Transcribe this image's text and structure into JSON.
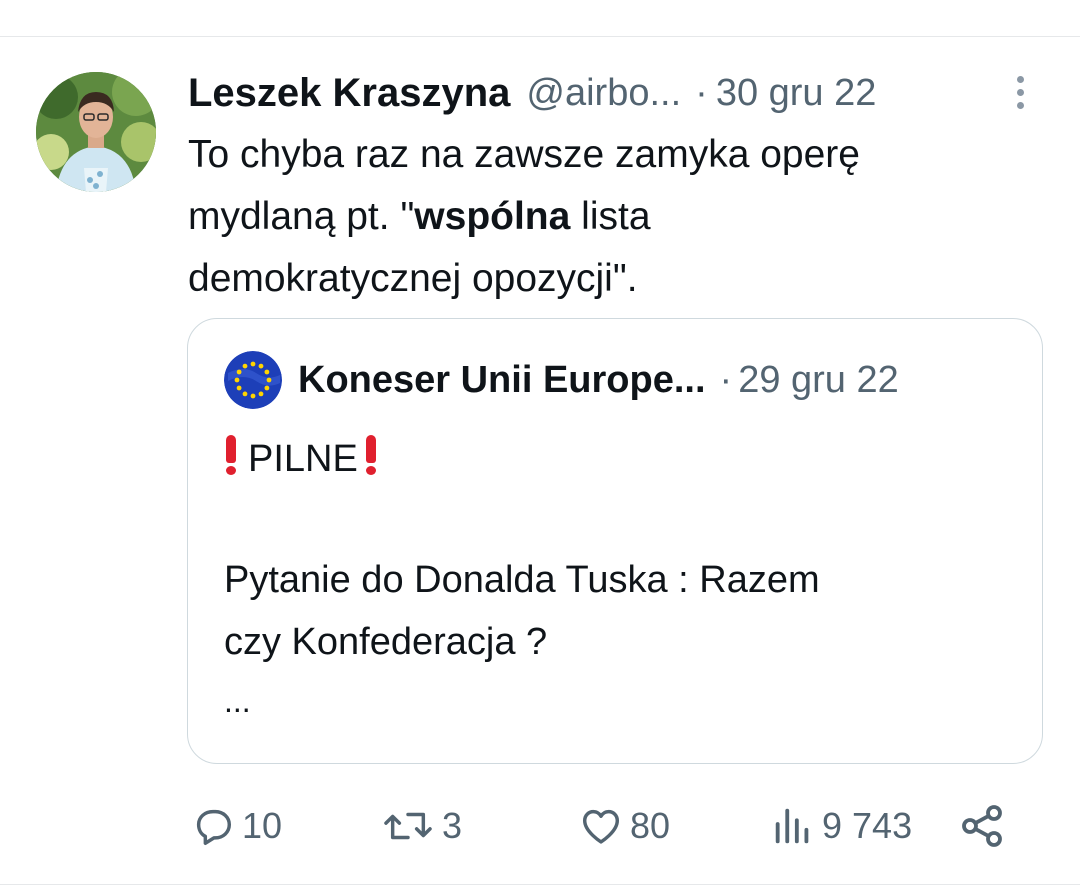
{
  "tweet": {
    "author_name": "Leszek Kraszyna",
    "author_handle": "@airbo...",
    "separator": "·",
    "date": "30 gru 22",
    "text_line1": "To chyba raz na zawsze zamyka operę",
    "text_line2_pre": "mydlaną pt. \"",
    "text_line2_bold": "wspólna",
    "text_line2_post": " lista",
    "text_line3": "demokratycznej opozycji\"."
  },
  "quote": {
    "author_name": "Koneser Unii Europe...",
    "separator": "·",
    "date": "29 gru 22",
    "headline": "PILNE",
    "body_line1": "Pytanie do Donalda Tuska : Razem",
    "body_line2": "czy Konfederacja ?",
    "ellipsis": "..."
  },
  "actions": {
    "replies": "10",
    "retweets": "3",
    "likes": "80",
    "views": "9 743"
  },
  "icons": {
    "more": "more-vertical-icon",
    "reply": "reply-icon",
    "retweet": "retweet-icon",
    "like": "heart-icon",
    "views": "views-icon",
    "share": "share-icon"
  },
  "colors": {
    "text": "#0f1419",
    "secondary": "#536471",
    "border": "#cfd9de",
    "alert": "#e0202e",
    "eu_blue": "#1d3fb8",
    "eu_star": "#ffd400"
  }
}
